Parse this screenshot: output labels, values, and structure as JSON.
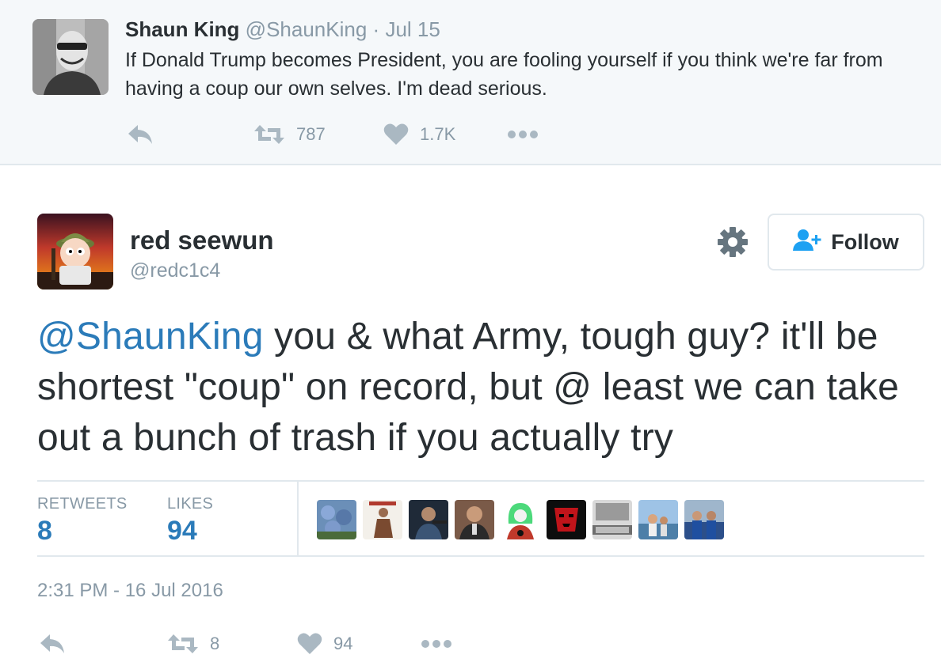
{
  "parent_tweet": {
    "name": "Shaun King",
    "handle": "@ShaunKing",
    "separator": "·",
    "date": "Jul 15",
    "text": "If Donald Trump becomes President, you are fooling yourself if you think we're far from having a coup our own selves. I'm dead serious.",
    "retweet_count": "787",
    "like_count": "1.7K"
  },
  "main_tweet": {
    "name": "red seewun",
    "handle": "@redc1c4",
    "follow_label": "Follow",
    "mention": "@ShaunKing",
    "text": " you & what Army, tough guy? it'll be shortest \"coup\" on record, but @ least we can take out a bunch of trash if you actually try",
    "retweets_label": "RETWEETS",
    "retweets_value": "8",
    "likes_label": "LIKES",
    "likes_value": "94",
    "timestamp": "2:31 PM - 16 Jul 2016",
    "action_retweet_count": "8",
    "action_like_count": "94"
  },
  "icons": [
    "reply-icon",
    "retweet-icon",
    "heart-icon",
    "more-icon",
    "gear-icon",
    "follow-person-icon"
  ],
  "colors": {
    "link": "#2b7bb9",
    "muted": "#8899a6",
    "icon": "#aab8c2",
    "parent_bg": "#f5f8fa",
    "border": "#e1e8ed"
  }
}
